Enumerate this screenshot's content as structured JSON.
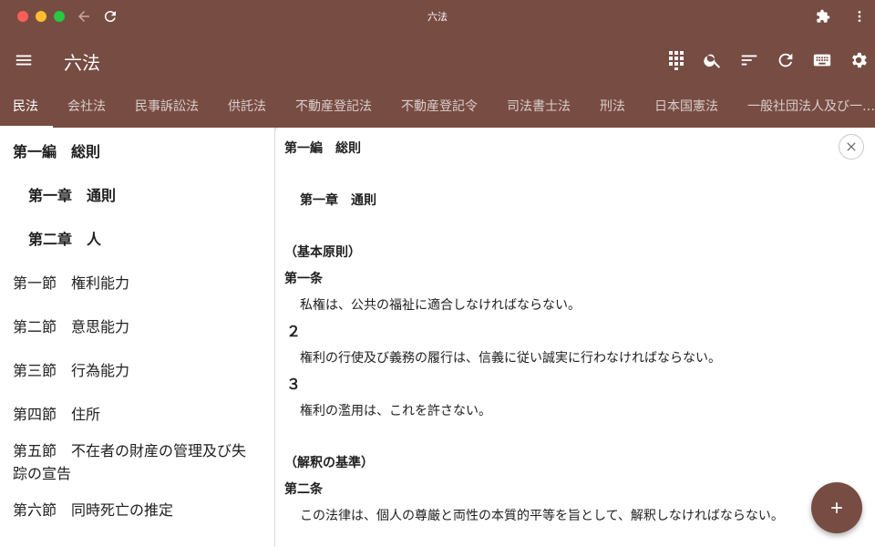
{
  "window": {
    "title": "六法",
    "icons": [
      "back-arrow-icon",
      "reload-icon",
      "extension-icon",
      "more-vert-icon"
    ]
  },
  "appbar": {
    "title": "六法",
    "icons": [
      "menu-icon",
      "apps-icon",
      "search-icon",
      "sort-icon",
      "refresh-icon",
      "keyboard-icon",
      "settings-icon"
    ]
  },
  "tabs": [
    {
      "label": "民法",
      "active": true
    },
    {
      "label": "会社法"
    },
    {
      "label": "民事訴訟法"
    },
    {
      "label": "供託法"
    },
    {
      "label": "不動産登記法"
    },
    {
      "label": "不動産登記令"
    },
    {
      "label": "司法書士法"
    },
    {
      "label": "刑法"
    },
    {
      "label": "日本国憲法"
    },
    {
      "label": "一般社団法人及び一…"
    }
  ],
  "toc": [
    {
      "label": "第一編　総則",
      "bold": true
    },
    {
      "label": "第一章　通則",
      "bold": true
    },
    {
      "label": "第二章　人",
      "bold": true
    },
    {
      "label": "第一節　権利能力"
    },
    {
      "label": "第二節　意思能力"
    },
    {
      "label": "第三節　行為能力"
    },
    {
      "label": "第四節　住所"
    },
    {
      "label": "第五節　不在者の財産の管理及び失"
    },
    {
      "label": "踪の宣告"
    },
    {
      "label": "第六節　同時死亡の推定"
    }
  ],
  "content": {
    "part": "第一編　総則",
    "chapter": "第一章　通則",
    "heading1": "（基本原則）",
    "article1": "第一条",
    "a1_p1": "私権は、公共の福祉に適合しなければならない。",
    "a1_n2": "２",
    "a1_p2": "権利の行使及び義務の履行は、信義に従い誠実に行わなければならない。",
    "a1_n3": "３",
    "a1_p3": "権利の濫用は、これを許さない。",
    "heading2": "（解釈の基準）",
    "article2": "第二条",
    "a2_p1": "この法律は、個人の尊厳と両性の本質的平等を旨として、解釈しなければならない。"
  },
  "colors": {
    "primary": "#774c43",
    "text": "#202020"
  },
  "buttons": {
    "close_icon": "close-icon",
    "fab_icon": "add-icon"
  }
}
